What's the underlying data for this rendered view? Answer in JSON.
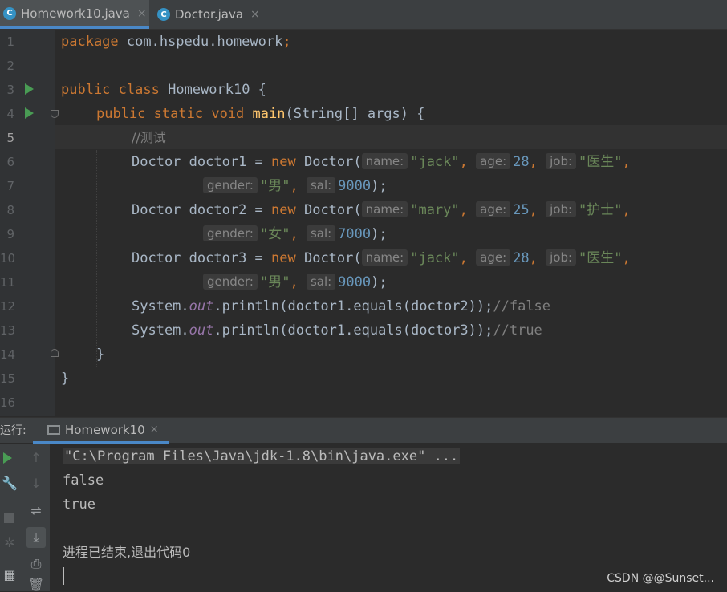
{
  "tabs": [
    {
      "label": "Homework10.java",
      "active": true,
      "icon": "java-class-icon"
    },
    {
      "label": "Doctor.java",
      "active": false,
      "icon": "java-class-icon"
    }
  ],
  "editor": {
    "line_numbers": [
      "1",
      "2",
      "3",
      "4",
      "5",
      "6",
      "7",
      "8",
      "9",
      "10",
      "11",
      "12",
      "13",
      "14",
      "15",
      "16"
    ],
    "current_line": 5,
    "tokens": {
      "package_kw": "package",
      "package_name": " com.hspedu.homework",
      "semicolon": ";",
      "public_kw": "public",
      "class_kw": "class",
      "class_name": " Homework10 {",
      "static_kw": "static",
      "void_kw": "void",
      "main_name": "main",
      "main_params": "(String[] args) {",
      "comment_test": "//测试",
      "doctor_type": "Doctor ",
      "d1": "doctor1 = ",
      "d2": "doctor2 = ",
      "d3": "doctor3 = ",
      "new_kw": "new",
      "ctor": " Doctor(",
      "hint_name": "name:",
      "hint_age": "age:",
      "hint_job": "job:",
      "hint_gender": "gender:",
      "hint_sal": "sal:",
      "jack": "\"jack\"",
      "mary": "\"mary\"",
      "age28": "28",
      "age25": "25",
      "job_doctor": "\"医生\"",
      "job_nurse": "\"护士\"",
      "male": "\"男\"",
      "female": "\"女\"",
      "sal9000": "9000",
      "sal7000": "7000",
      "comma": ", ",
      "close_call": ");",
      "system": "System.",
      "out": "out",
      "println1": ".println(doctor1.equals(doctor2));",
      "println2": ".println(doctor1.equals(doctor3));",
      "cmt_false": "//false",
      "cmt_true": "//true",
      "close_brace": "}"
    }
  },
  "run_panel": {
    "label": "运行:",
    "tab_label": "Homework10",
    "close": "×",
    "output": [
      "\"C:\\Program Files\\Java\\jdk-1.8\\bin\\java.exe\" ...",
      "false",
      "true",
      "",
      "进程已结束,退出代码0"
    ]
  },
  "watermark": "CSDN @@Sunset...",
  "colors": {
    "accent": "#4a88c7",
    "keyword": "#cc7832",
    "string": "#6a8759",
    "number": "#6897bb",
    "run_green": "#499c54"
  }
}
